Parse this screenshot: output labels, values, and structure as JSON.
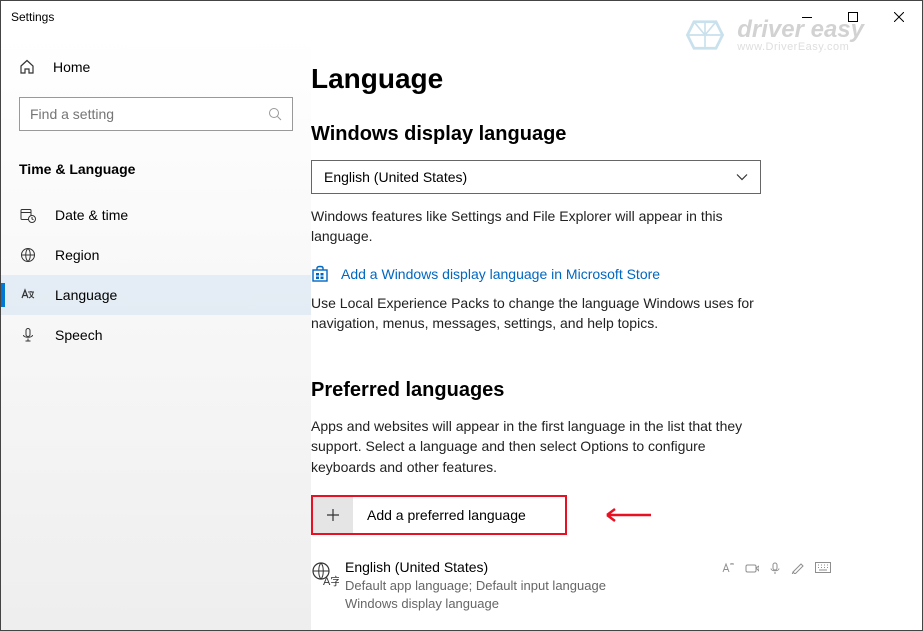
{
  "window": {
    "title": "Settings"
  },
  "sidebar": {
    "home_label": "Home",
    "search_placeholder": "Find a setting",
    "section_title": "Time & Language",
    "items": [
      {
        "label": "Date & time"
      },
      {
        "label": "Region"
      },
      {
        "label": "Language"
      },
      {
        "label": "Speech"
      }
    ]
  },
  "page": {
    "title": "Language",
    "display_lang": {
      "heading": "Windows display language",
      "selected": "English (United States)",
      "desc": "Windows features like Settings and File Explorer will appear in this language.",
      "store_link": "Add a Windows display language in Microsoft Store",
      "packs_desc": "Use Local Experience Packs to change the language Windows uses for navigation, menus, messages, settings, and help topics."
    },
    "preferred": {
      "heading": "Preferred languages",
      "desc": "Apps and websites will appear in the first language in the list that they support. Select a language and then select Options to configure keyboards and other features.",
      "add_label": "Add a preferred language",
      "entries": [
        {
          "name": "English (United States)",
          "sub1": "Default app language; Default input language",
          "sub2": "Windows display language"
        }
      ]
    }
  },
  "watermark": {
    "brand": "driver easy",
    "url": "www.DriverEasy.com"
  }
}
